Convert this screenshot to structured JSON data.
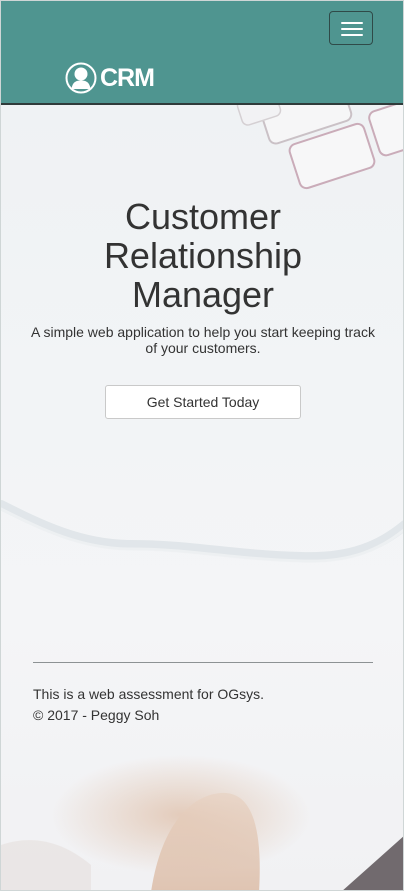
{
  "navbar": {
    "brand_text": "CRM",
    "brand_icon": "user-silhouette-icon",
    "menu_icon": "hamburger-menu-icon",
    "background_color": "#4f9590"
  },
  "hero": {
    "title_line1": "Customer",
    "title_line2": "Relationship",
    "title_line3": "Manager",
    "subtitle": "A simple web application to help you start keeping track of your customers.",
    "cta_label": "Get Started Today"
  },
  "footer": {
    "line1": "This is a web assessment for OGsys.",
    "line2": "© 2017 - Peggy Soh"
  }
}
